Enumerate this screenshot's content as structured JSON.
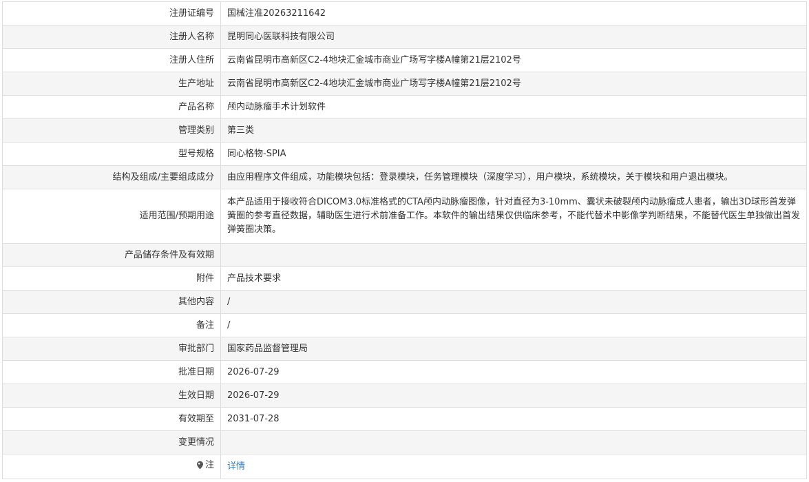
{
  "rows": [
    {
      "label": "注册证编号",
      "value": "国械注准20263211642"
    },
    {
      "label": "注册人名称",
      "value": "昆明同心医联科技有限公司"
    },
    {
      "label": "注册人住所",
      "value": "云南省昆明市高新区C2-4地块汇金城市商业广场写字楼A幢第21层2102号"
    },
    {
      "label": "生产地址",
      "value": "云南省昆明市高新区C2-4地块汇金城市商业广场写字楼A幢第21层2102号"
    },
    {
      "label": "产品名称",
      "value": "颅内动脉瘤手术计划软件"
    },
    {
      "label": "管理类别",
      "value": "第三类"
    },
    {
      "label": "型号规格",
      "value": "同心格物-SPIA"
    },
    {
      "label": "结构及组成/主要组成成分",
      "value": "由应用程序文件组成，功能模块包括：登录模块，任务管理模块（深度学习），用户模块，系统模块，关于模块和用户退出模块。"
    },
    {
      "label": "适用范围/预期用途",
      "value": "本产品适用于接收符合DICOM3.0标准格式的CTA颅内动脉瘤图像，针对直径为3-10mm、囊状未破裂颅内动脉瘤成人患者，输出3D球形首发弹簧圈的参考直径数据，辅助医生进行术前准备工作。本软件的输出结果仅供临床参考，不能代替术中影像学判断结果，不能替代医生单独做出首发弹簧圈决策。"
    },
    {
      "label": "产品储存条件及有效期",
      "value": ""
    },
    {
      "label": "附件",
      "value": "产品技术要求"
    },
    {
      "label": "其他内容",
      "value": "/"
    },
    {
      "label": "备注",
      "value": "/"
    },
    {
      "label": "审批部门",
      "value": "国家药品监督管理局"
    },
    {
      "label": "批准日期",
      "value": "2026-07-29"
    },
    {
      "label": "生效日期",
      "value": "2026-07-29"
    },
    {
      "label": "有效期至",
      "value": "2031-07-28"
    },
    {
      "label": "变更情况",
      "value": ""
    }
  ],
  "note_row": {
    "label": "注",
    "icon": "pin-icon",
    "link_text": "详情",
    "link_color": "#337ab7"
  }
}
